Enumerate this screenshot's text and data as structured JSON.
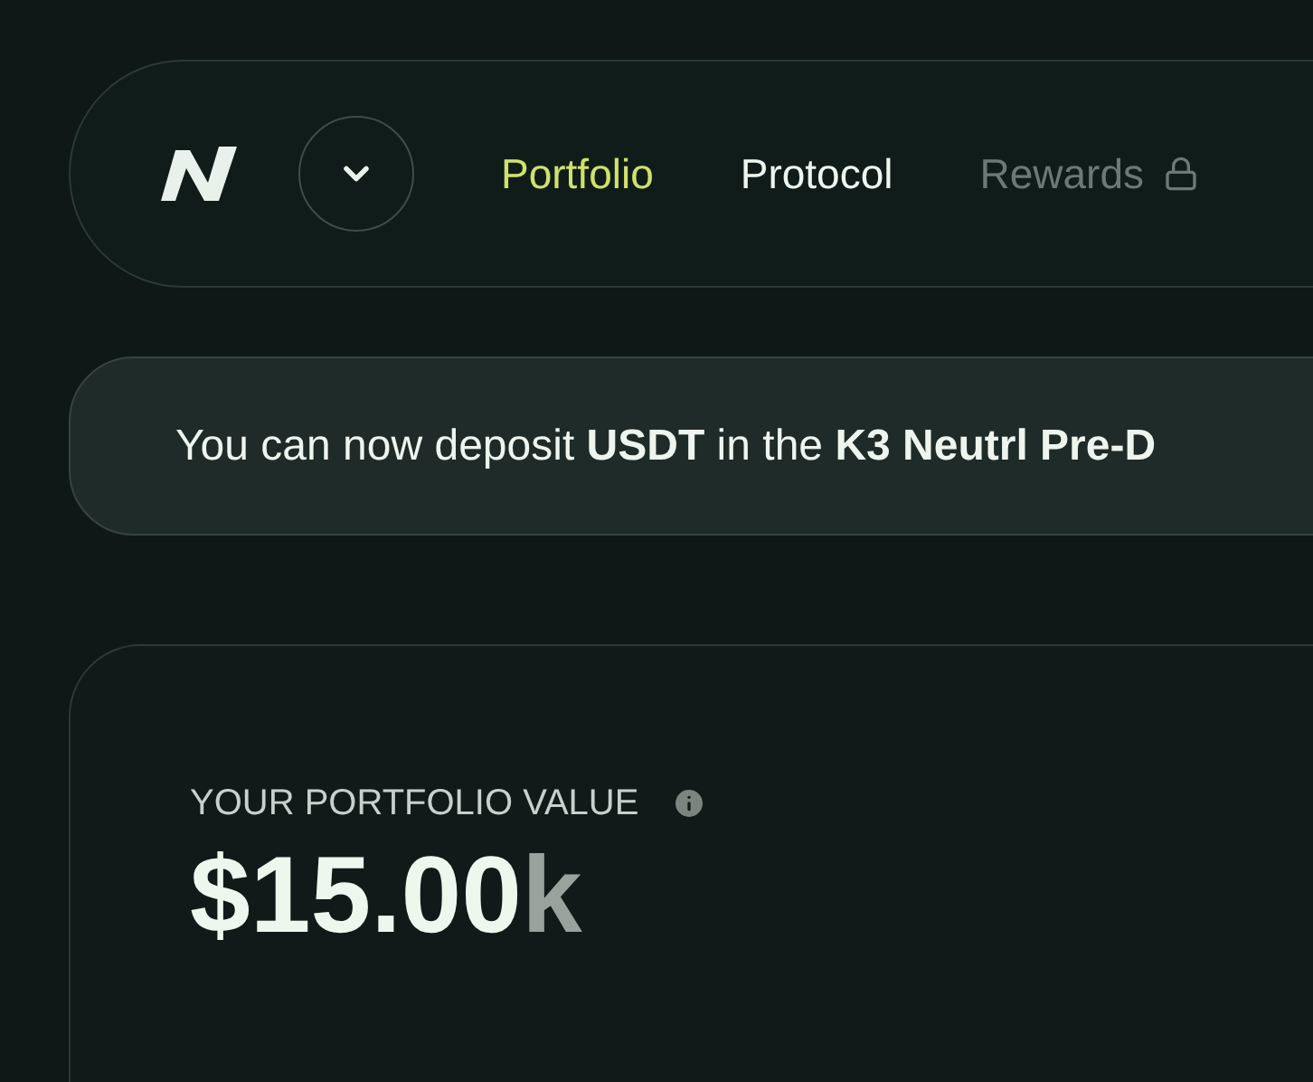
{
  "nav": {
    "tabs": [
      {
        "label": "Portfolio",
        "selected": true,
        "locked": false
      },
      {
        "label": "Protocol",
        "selected": false,
        "locked": false
      },
      {
        "label": "Rewards",
        "selected": false,
        "locked": true
      }
    ]
  },
  "banner": {
    "text": "You can now deposit **USDT** in the **K3 Neutrl Pre-D**"
  },
  "portfolio": {
    "label": "YOUR PORTFOLIO VALUE",
    "value": "$15.00",
    "suffix": "k"
  }
}
